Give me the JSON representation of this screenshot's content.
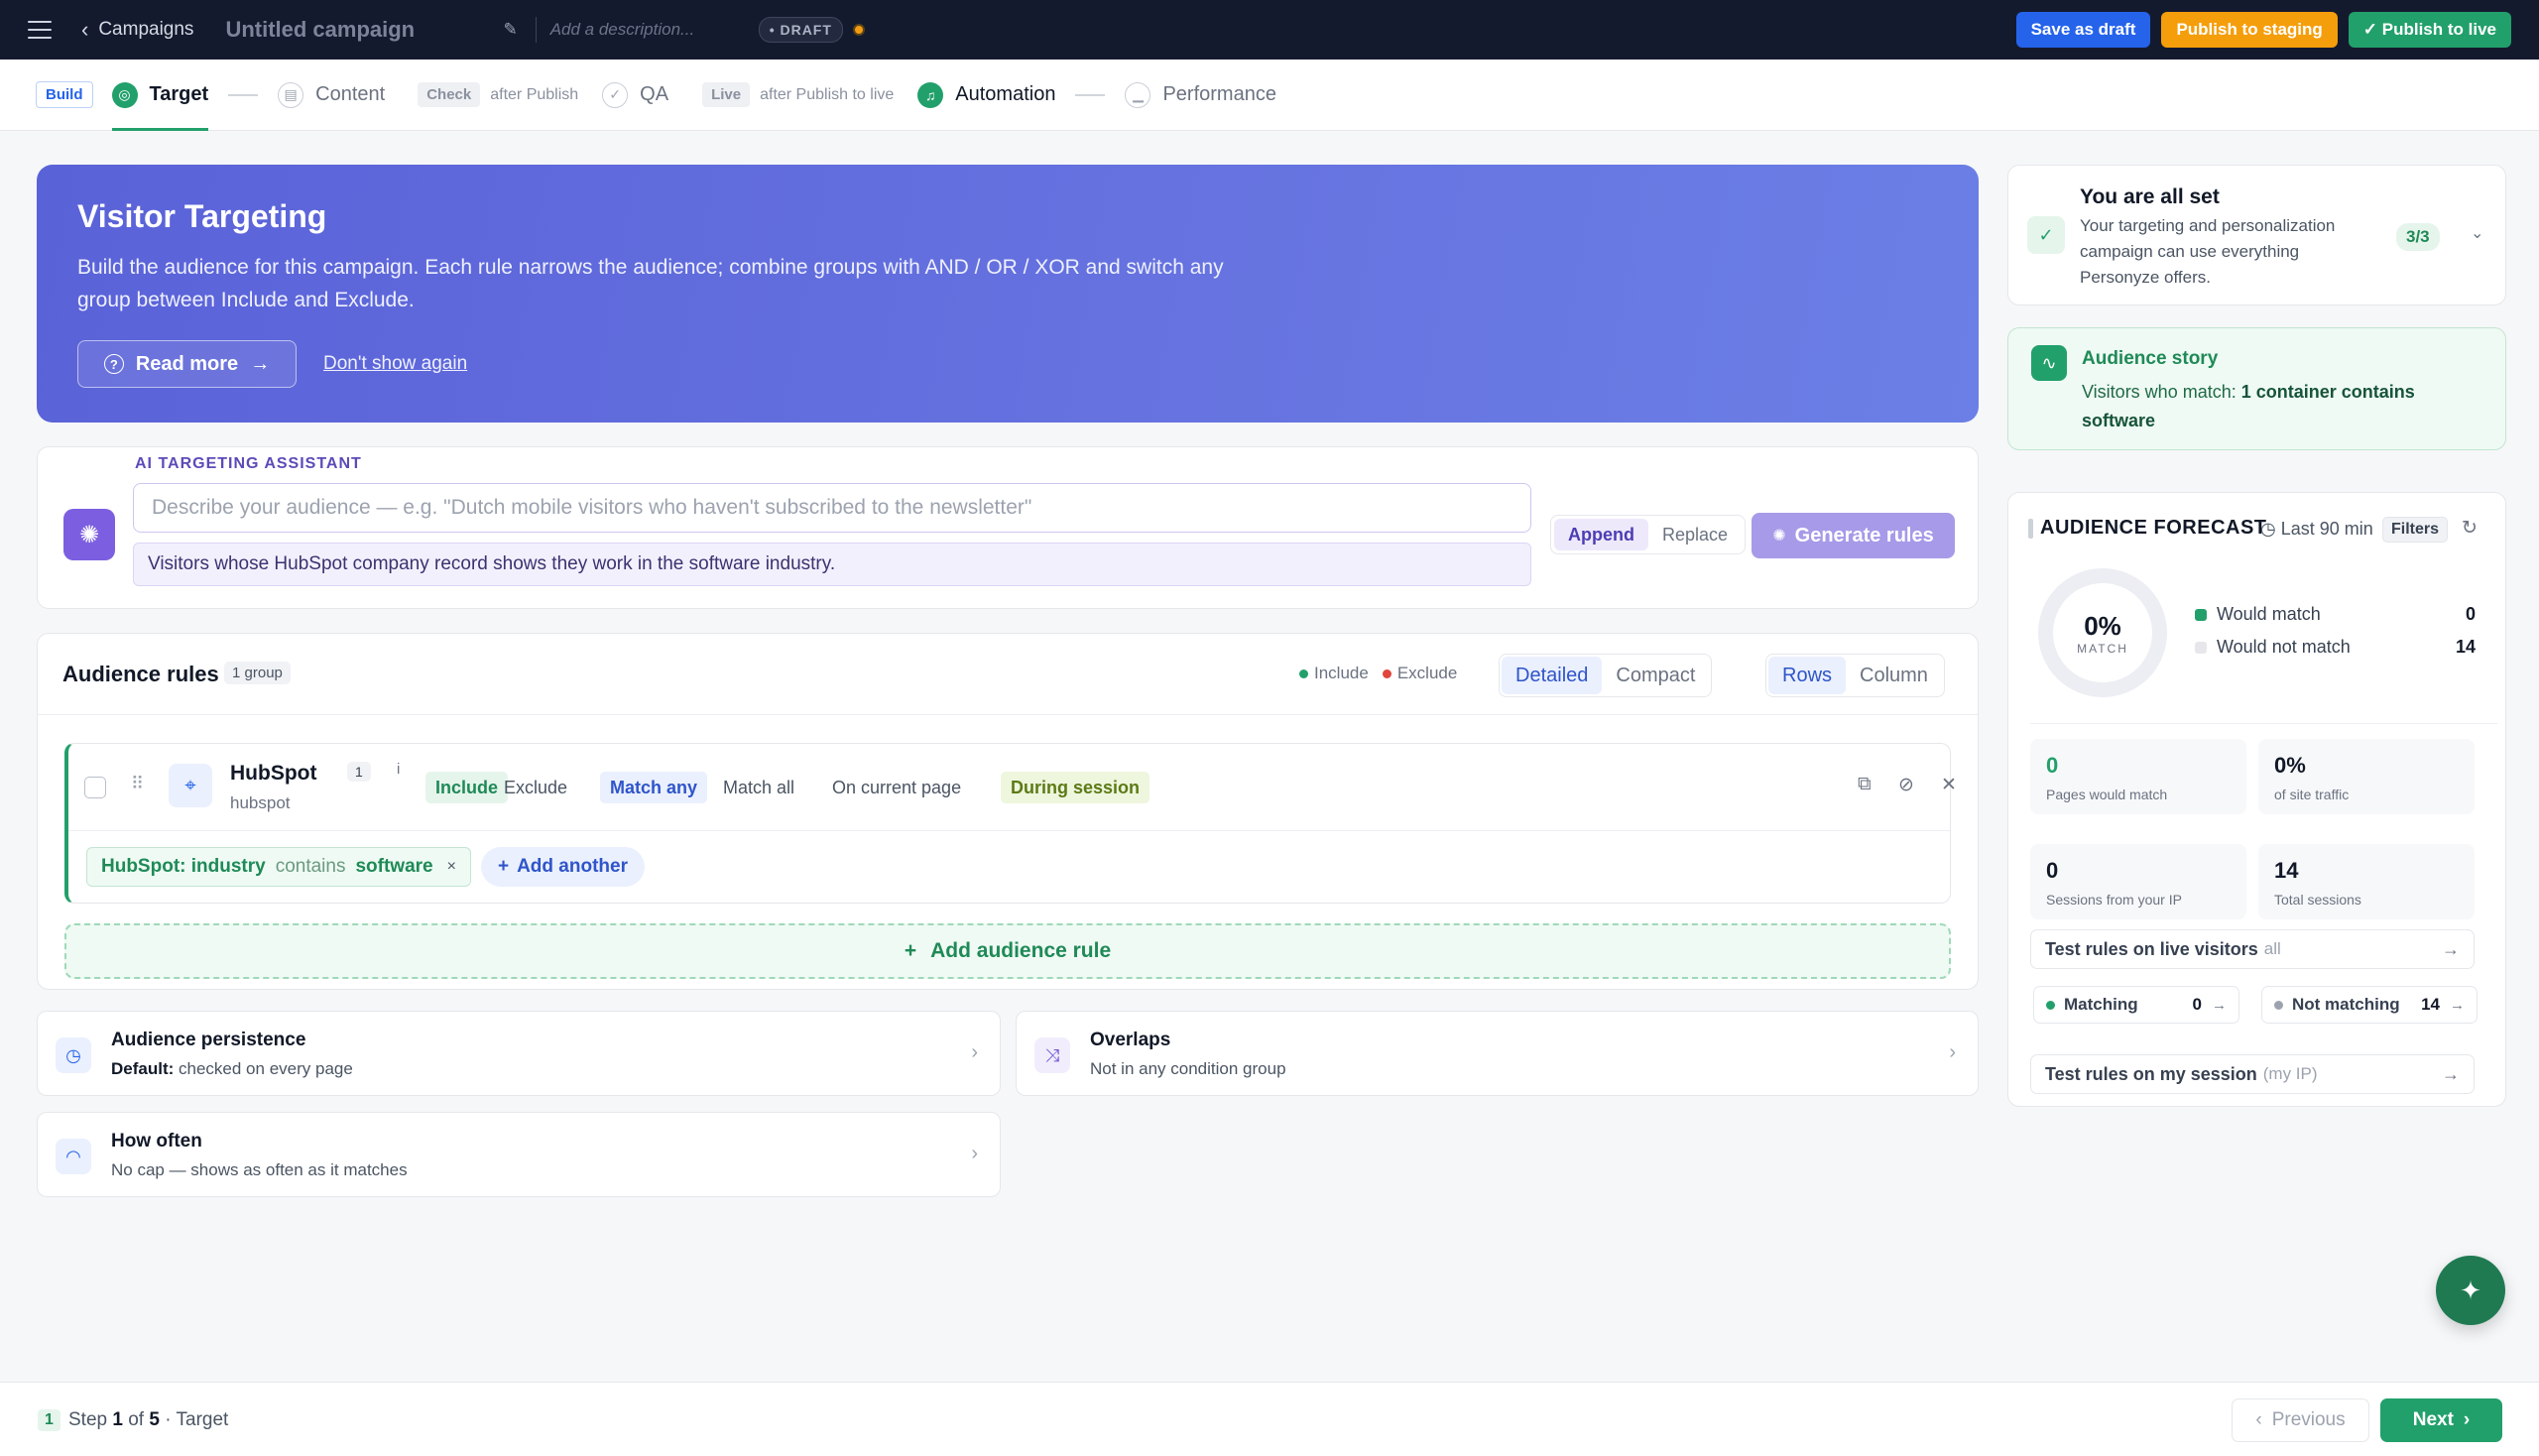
{
  "topbar": {
    "back_label": "Campaigns",
    "campaign_title": "Untitled campaign",
    "description_placeholder": "Add a description...",
    "status_badge": "• DRAFT",
    "save_draft": "Save as draft",
    "publish_staging": "Publish to staging",
    "publish_live": "✓ Publish to live",
    "colors": {
      "bar": "#141a2e",
      "draft_btn": "#2563eb",
      "staging_btn": "#f59e0b",
      "live_btn": "#22a06b"
    }
  },
  "steps": {
    "build_tag": "Build",
    "target": "Target",
    "content": "Content",
    "check_tag": "Check",
    "check_after": "after Publish",
    "qa": "QA",
    "live_tag": "Live",
    "live_after": "after Publish to live",
    "automation": "Automation",
    "performance": "Performance"
  },
  "hero": {
    "title": "Visitor Targeting",
    "text": "Build the audience for this campaign. Each rule narrows the audience; combine groups with AND / OR / XOR and switch any group between Include and Exclude.",
    "read_more": "Read more",
    "dont_show": "Don't show again"
  },
  "ai": {
    "label": "AI TARGETING ASSISTANT",
    "placeholder": "Describe your audience — e.g. \"Dutch mobile visitors who haven't subscribed to the newsletter\"",
    "suggestion": "Visitors whose HubSpot company record shows they work in the software industry.",
    "append": "Append",
    "replace": "Replace",
    "generate": "Generate rules"
  },
  "rules": {
    "title": "Audience rules",
    "count": "1 group",
    "legend_include": "Include",
    "legend_exclude": "Exclude",
    "view_detailed": "Detailed",
    "view_compact": "Compact",
    "layout_rows": "Rows",
    "layout_column": "Column",
    "card": {
      "name": "HubSpot",
      "count": "1",
      "info": "i",
      "sub": "hubspot",
      "include": "Include",
      "exclude": "Exclude",
      "match_any": "Match any",
      "match_all": "Match all",
      "on_page": "On current page",
      "during_session": "During session",
      "condition": {
        "field": "HubSpot: industry",
        "operator": "contains",
        "value": "software"
      },
      "add_another": "Add another"
    },
    "add_rule": "Add audience rule"
  },
  "settings": {
    "persistence": {
      "title": "Audience persistence",
      "prefix": "Default:",
      "sub": "checked on every page"
    },
    "overlaps": {
      "title": "Overlaps",
      "sub": "Not in any condition group"
    },
    "how_often": {
      "title": "How often",
      "sub": "No cap — shows as often as it matches"
    }
  },
  "allset": {
    "title": "You are all set",
    "text": "Your targeting and personalization campaign can use everything Personyze offers.",
    "badge": "3/3"
  },
  "story": {
    "title": "Audience story",
    "prefix": "Visitors who match:",
    "bold": "1 container contains software"
  },
  "forecast": {
    "title": "AUDIENCE FORECAST",
    "range": "Last 90 min",
    "filters": "Filters",
    "match_pct": "0%",
    "match_label": "MATCH",
    "would_match_label": "Would match",
    "would_match": "0",
    "would_not_match_label": "Would not match",
    "would_not_match": "14",
    "pages_match": "0",
    "pages_match_label": "Pages would match",
    "site_traffic": "0%",
    "site_traffic_label": "of site traffic",
    "sessions_ip": "0",
    "sessions_ip_label": "Sessions from your IP",
    "total_sessions": "14",
    "total_sessions_label": "Total sessions",
    "test_live": "Test rules on live visitors",
    "test_live_muted": "all",
    "matching_label": "Matching",
    "matching": "0",
    "not_matching_label": "Not matching",
    "not_matching": "14",
    "test_session": "Test rules on my session",
    "test_session_muted": "(my IP)"
  },
  "footer": {
    "step_num": "1",
    "step_word": "Step",
    "step_current": "1",
    "of_word": "of",
    "step_total": "5",
    "step_name": "· Target",
    "previous": "Previous",
    "next": "Next"
  }
}
